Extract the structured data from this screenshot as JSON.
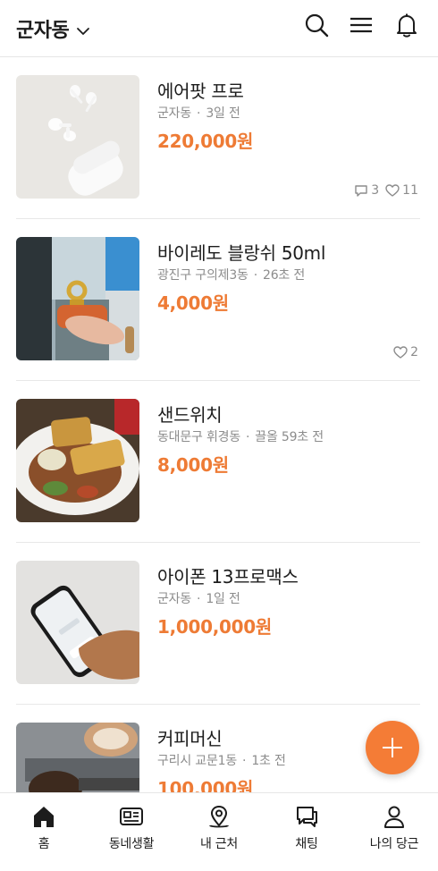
{
  "header": {
    "location": "군자동",
    "icons": [
      "chevron-down-icon",
      "search-icon",
      "menu-icon",
      "bell-icon"
    ]
  },
  "items": [
    {
      "title": "에어팟 프로",
      "location": "군자동",
      "time": "3일 전",
      "price": "220,000원",
      "chat_count": "3",
      "like_count": "11"
    },
    {
      "title": "바이레도 블랑쉬 50ml",
      "location": "광진구 구의제3동",
      "time": "26초 전",
      "price": "4,000원",
      "like_count": "2"
    },
    {
      "title": "샌드위치",
      "location": "동대문구 휘경동",
      "time": "끌올 59초 전",
      "price": "8,000원"
    },
    {
      "title": "아이폰 13프로맥스",
      "location": "군자동",
      "time": "1일 전",
      "price": "1,000,000원"
    },
    {
      "title": "커피머신",
      "location": "구리시 교문1동",
      "time": "1초 전",
      "price": "100,000원"
    }
  ],
  "fab": {
    "icon": "plus-icon"
  },
  "nav": [
    {
      "label": "홈",
      "icon": "home-icon"
    },
    {
      "label": "동네생활",
      "icon": "newspaper-icon"
    },
    {
      "label": "내 근처",
      "icon": "location-pin-icon"
    },
    {
      "label": "채팅",
      "icon": "chat-icon"
    },
    {
      "label": "나의 당근",
      "icon": "person-icon"
    }
  ],
  "colors": {
    "accent": "#ee7b35",
    "fab": "#f47c36",
    "meta": "#8c8c8c"
  }
}
